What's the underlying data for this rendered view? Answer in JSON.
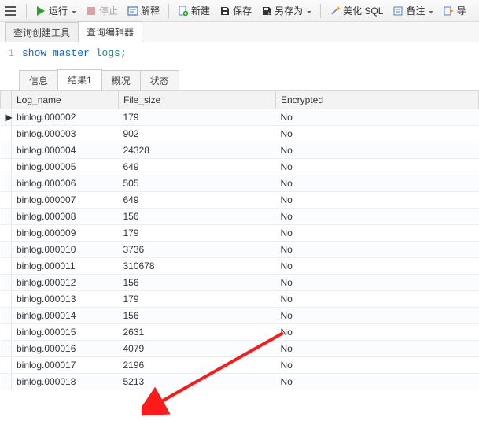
{
  "toolbar": {
    "run": "运行",
    "stop": "停止",
    "explain": "解释",
    "new": "新建",
    "save": "保存",
    "saveas": "另存为",
    "beautify": "美化 SQL",
    "notes": "备注",
    "export": "导"
  },
  "topTabs": {
    "builder": "查询创建工具",
    "editor": "查询编辑器"
  },
  "editor": {
    "line": "1",
    "kw_show": "show",
    "kw_master": "master",
    "kw_logs": "logs",
    "semi": ";"
  },
  "resultTabs": {
    "info": "信息",
    "result1": "结果1",
    "overview": "概况",
    "status": "状态"
  },
  "grid": {
    "headers": {
      "log_name": "Log_name",
      "file_size": "File_size",
      "encrypted": "Encrypted"
    },
    "rows": [
      {
        "log_name": "binlog.000002",
        "file_size": "179",
        "encrypted": "No"
      },
      {
        "log_name": "binlog.000003",
        "file_size": "902",
        "encrypted": "No"
      },
      {
        "log_name": "binlog.000004",
        "file_size": "24328",
        "encrypted": "No"
      },
      {
        "log_name": "binlog.000005",
        "file_size": "649",
        "encrypted": "No"
      },
      {
        "log_name": "binlog.000006",
        "file_size": "505",
        "encrypted": "No"
      },
      {
        "log_name": "binlog.000007",
        "file_size": "649",
        "encrypted": "No"
      },
      {
        "log_name": "binlog.000008",
        "file_size": "156",
        "encrypted": "No"
      },
      {
        "log_name": "binlog.000009",
        "file_size": "179",
        "encrypted": "No"
      },
      {
        "log_name": "binlog.000010",
        "file_size": "3736",
        "encrypted": "No"
      },
      {
        "log_name": "binlog.000011",
        "file_size": "310678",
        "encrypted": "No"
      },
      {
        "log_name": "binlog.000012",
        "file_size": "156",
        "encrypted": "No"
      },
      {
        "log_name": "binlog.000013",
        "file_size": "179",
        "encrypted": "No"
      },
      {
        "log_name": "binlog.000014",
        "file_size": "156",
        "encrypted": "No"
      },
      {
        "log_name": "binlog.000015",
        "file_size": "2631",
        "encrypted": "No"
      },
      {
        "log_name": "binlog.000016",
        "file_size": "4079",
        "encrypted": "No"
      },
      {
        "log_name": "binlog.000017",
        "file_size": "2196",
        "encrypted": "No"
      },
      {
        "log_name": "binlog.000018",
        "file_size": "5213",
        "encrypted": "No"
      }
    ]
  },
  "pointerGlyph": "▶"
}
